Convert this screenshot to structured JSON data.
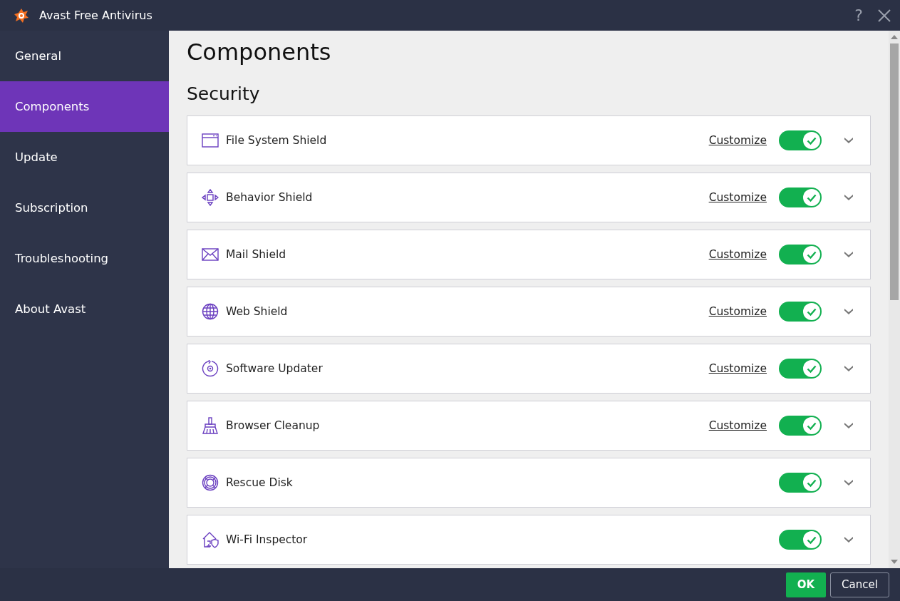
{
  "window": {
    "title": "Avast Free Antivirus",
    "help": "?"
  },
  "sidebar": {
    "items": [
      {
        "label": "General",
        "selected": false
      },
      {
        "label": "Components",
        "selected": true
      },
      {
        "label": "Update",
        "selected": false
      },
      {
        "label": "Subscription",
        "selected": false
      },
      {
        "label": "Troubleshooting",
        "selected": false
      },
      {
        "label": "About Avast",
        "selected": false
      }
    ]
  },
  "page": {
    "title": "Components",
    "section": "Security"
  },
  "components": [
    {
      "name": "File System Shield",
      "link": "Customize",
      "on": true
    },
    {
      "name": "Behavior Shield",
      "link": "Customize",
      "on": true
    },
    {
      "name": "Mail Shield",
      "link": "Customize",
      "on": true
    },
    {
      "name": "Web Shield",
      "link": "Customize",
      "on": true
    },
    {
      "name": "Software Updater",
      "link": "Customize",
      "on": true
    },
    {
      "name": "Browser Cleanup",
      "link": "Customize",
      "on": true
    },
    {
      "name": "Rescue Disk",
      "on": true
    },
    {
      "name": "Wi-Fi Inspector",
      "on": true
    }
  ],
  "buttons": {
    "ok": "OK",
    "cancel": "Cancel"
  }
}
